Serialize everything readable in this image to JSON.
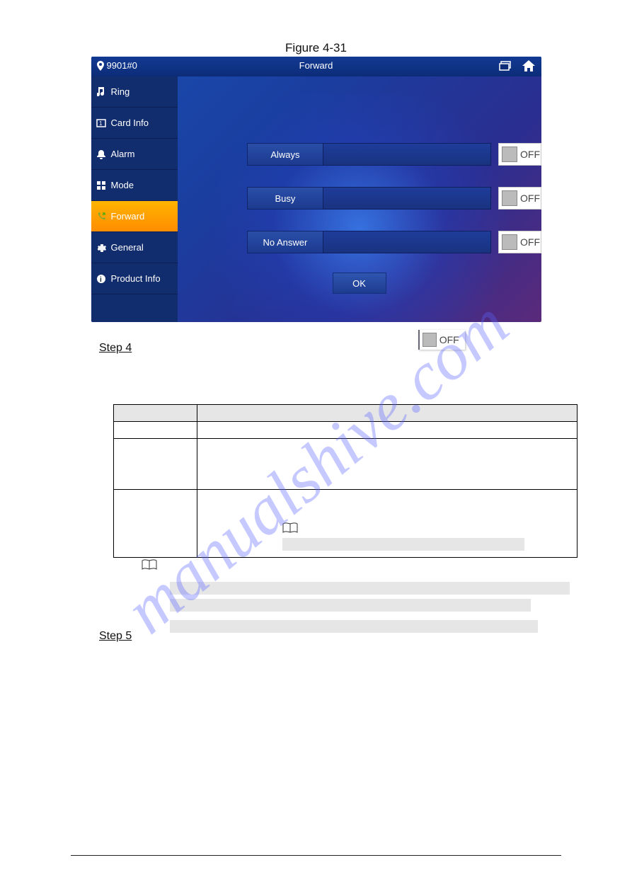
{
  "figure_caption": "Figure 4-31",
  "header": {
    "location": "9901#0",
    "title": "Forward"
  },
  "sidebar": {
    "items": [
      {
        "label": "Ring",
        "icon": "note-icon"
      },
      {
        "label": "Card Info",
        "icon": "card-icon"
      },
      {
        "label": "Alarm",
        "icon": "bell-icon"
      },
      {
        "label": "Mode",
        "icon": "tiles-icon"
      },
      {
        "label": "Forward",
        "icon": "phone-forward-icon",
        "selected": true
      },
      {
        "label": "General",
        "icon": "gear-icon"
      },
      {
        "label": "Product Info",
        "icon": "info-icon"
      }
    ]
  },
  "forward": {
    "rows": [
      {
        "label": "Always",
        "state": "OFF"
      },
      {
        "label": "Busy",
        "state": "OFF"
      },
      {
        "label": "No Answer",
        "state": "OFF"
      }
    ],
    "ok": "OK"
  },
  "floating_toggle_state": "OFF",
  "steps": {
    "four": "Step 4",
    "five": "Step 5"
  },
  "watermark": "manualshive.com"
}
